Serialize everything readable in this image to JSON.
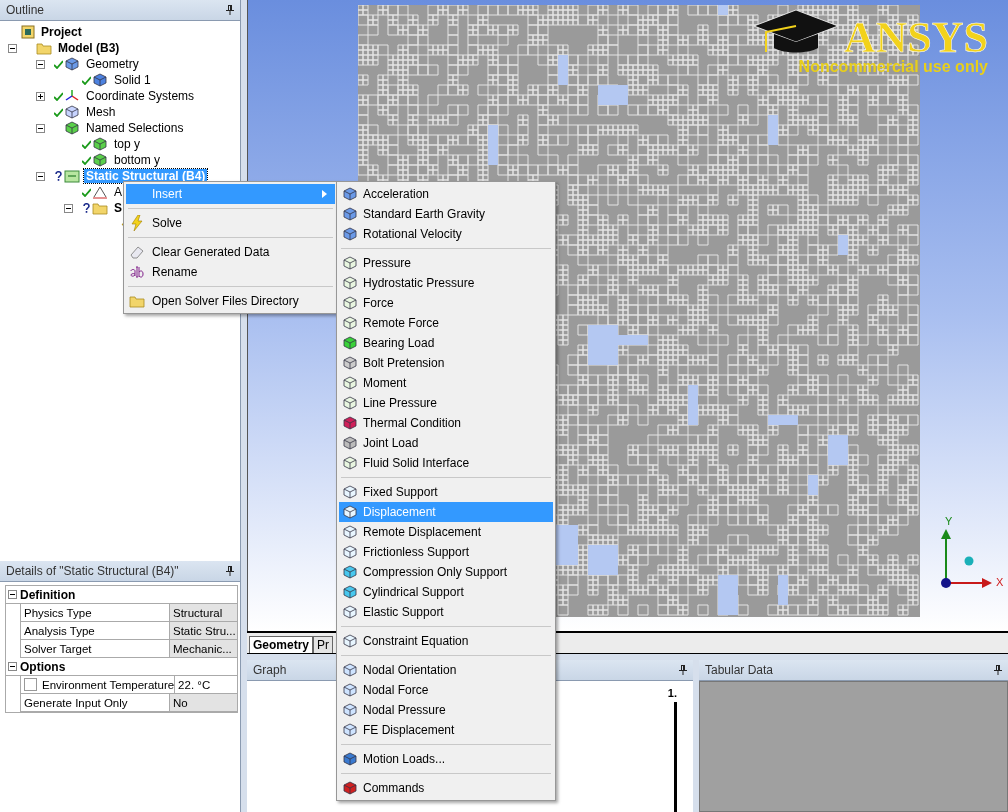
{
  "outline": {
    "title": "Outline",
    "tree": [
      {
        "label": "Project",
        "kind": "project",
        "ok": false,
        "incomplete": false,
        "selected": false,
        "children": [
          {
            "label": "Model (B3)",
            "kind": "model",
            "ok": false,
            "incomplete": false,
            "selected": false,
            "expanded": true,
            "children": [
              {
                "label": "Geometry",
                "kind": "geometry",
                "ok": true,
                "incomplete": false,
                "selected": false,
                "expanded": true,
                "children": [
                  {
                    "label": "Solid 1",
                    "kind": "body",
                    "ok": true,
                    "incomplete": false,
                    "selected": false
                  }
                ]
              },
              {
                "label": "Coordinate Systems",
                "kind": "axes",
                "ok": true,
                "incomplete": false,
                "selected": false,
                "expanded": false
              },
              {
                "label": "Mesh",
                "kind": "mesh",
                "ok": true,
                "incomplete": false,
                "selected": false
              },
              {
                "label": "Named Selections",
                "kind": "selection",
                "ok": false,
                "incomplete": false,
                "selected": false,
                "expanded": true,
                "children": [
                  {
                    "label": "top y",
                    "kind": "selection",
                    "ok": true,
                    "incomplete": false,
                    "selected": false
                  },
                  {
                    "label": "bottom y",
                    "kind": "selection",
                    "ok": true,
                    "incomplete": false,
                    "selected": false
                  }
                ]
              },
              {
                "label": "Static Structural (B4)",
                "kind": "analysis",
                "ok": false,
                "incomplete": true,
                "selected": true,
                "expanded": true,
                "children": [
                  {
                    "label": "A",
                    "kind": "settings",
                    "ok": true,
                    "incomplete": false,
                    "selected": false
                  },
                  {
                    "label": "S",
                    "kind": "solution",
                    "ok": false,
                    "incomplete": true,
                    "selected": false,
                    "expanded": true,
                    "children": [
                      {
                        "kind": "solution-info",
                        "ok": false,
                        "incomplete": false
                      }
                    ]
                  }
                ]
              }
            ]
          }
        ]
      }
    ]
  },
  "details": {
    "title": "Details of \"Static Structural (B4)\"",
    "groups": [
      {
        "title": "Definition",
        "expanded": true,
        "rows": [
          {
            "label": "Physics Type",
            "value": "Structural",
            "readonly": true
          },
          {
            "label": "Analysis Type",
            "value": "Static Stru...",
            "readonly": true
          },
          {
            "label": "Solver Target",
            "value": "Mechanic...",
            "readonly": true
          }
        ]
      },
      {
        "title": "Options",
        "expanded": true,
        "rows": [
          {
            "label": "Environment Temperature",
            "value": "22. °C",
            "readonly": false,
            "checkbox": {
              "checked": false
            }
          },
          {
            "label": "Generate Input Only",
            "value": "No",
            "readonly": true
          }
        ]
      }
    ]
  },
  "viewport": {
    "logo": {
      "brand": "ANSYS",
      "notice": "Noncommercial use only"
    },
    "triad": {
      "x": "X",
      "y": "Y"
    },
    "tabs": [
      {
        "label": "Geometry",
        "selected": true
      },
      {
        "label": "Pr",
        "selected": false
      }
    ]
  },
  "graph": {
    "title": "Graph",
    "marker": "1."
  },
  "tabular_data": {
    "title": "Tabular Data"
  },
  "context_menu": {
    "groups": [
      [
        {
          "label": "Insert",
          "selected": true,
          "has_submenu": true
        }
      ],
      [
        {
          "label": "Solve",
          "selected": false,
          "has_submenu": false
        }
      ],
      [
        {
          "label": "Clear Generated Data",
          "selected": false,
          "has_submenu": false
        },
        {
          "label": "Rename",
          "selected": false,
          "has_submenu": false
        }
      ],
      [
        {
          "label": "Open Solver Files Directory",
          "selected": false,
          "has_submenu": false
        }
      ]
    ]
  },
  "insert_submenu": {
    "groups": [
      [
        {
          "label": "Acceleration",
          "selected": false
        },
        {
          "label": "Standard Earth Gravity",
          "selected": false
        },
        {
          "label": "Rotational Velocity",
          "selected": false
        }
      ],
      [
        {
          "label": "Pressure",
          "selected": false
        },
        {
          "label": "Hydrostatic Pressure",
          "selected": false
        },
        {
          "label": "Force",
          "selected": false
        },
        {
          "label": "Remote Force",
          "selected": false
        },
        {
          "label": "Bearing Load",
          "selected": false
        },
        {
          "label": "Bolt Pretension",
          "selected": false
        },
        {
          "label": "Moment",
          "selected": false
        },
        {
          "label": "Line Pressure",
          "selected": false
        },
        {
          "label": "Thermal Condition",
          "selected": false
        },
        {
          "label": "Joint Load",
          "selected": false
        },
        {
          "label": "Fluid Solid Interface",
          "selected": false
        }
      ],
      [
        {
          "label": "Fixed Support",
          "selected": false
        },
        {
          "label": "Displacement",
          "selected": true
        },
        {
          "label": "Remote Displacement",
          "selected": false
        },
        {
          "label": "Frictionless Support",
          "selected": false
        },
        {
          "label": "Compression Only Support",
          "selected": false
        },
        {
          "label": "Cylindrical Support",
          "selected": false
        },
        {
          "label": "Elastic Support",
          "selected": false
        }
      ],
      [
        {
          "label": "Constraint Equation",
          "selected": false
        }
      ],
      [
        {
          "label": "Nodal Orientation",
          "selected": false
        },
        {
          "label": "Nodal Force",
          "selected": false
        },
        {
          "label": "Nodal Pressure",
          "selected": false
        },
        {
          "label": "FE Displacement",
          "selected": false
        }
      ],
      [
        {
          "label": "Motion Loads...",
          "selected": false
        }
      ],
      [
        {
          "label": "Commands",
          "selected": false
        }
      ]
    ]
  }
}
